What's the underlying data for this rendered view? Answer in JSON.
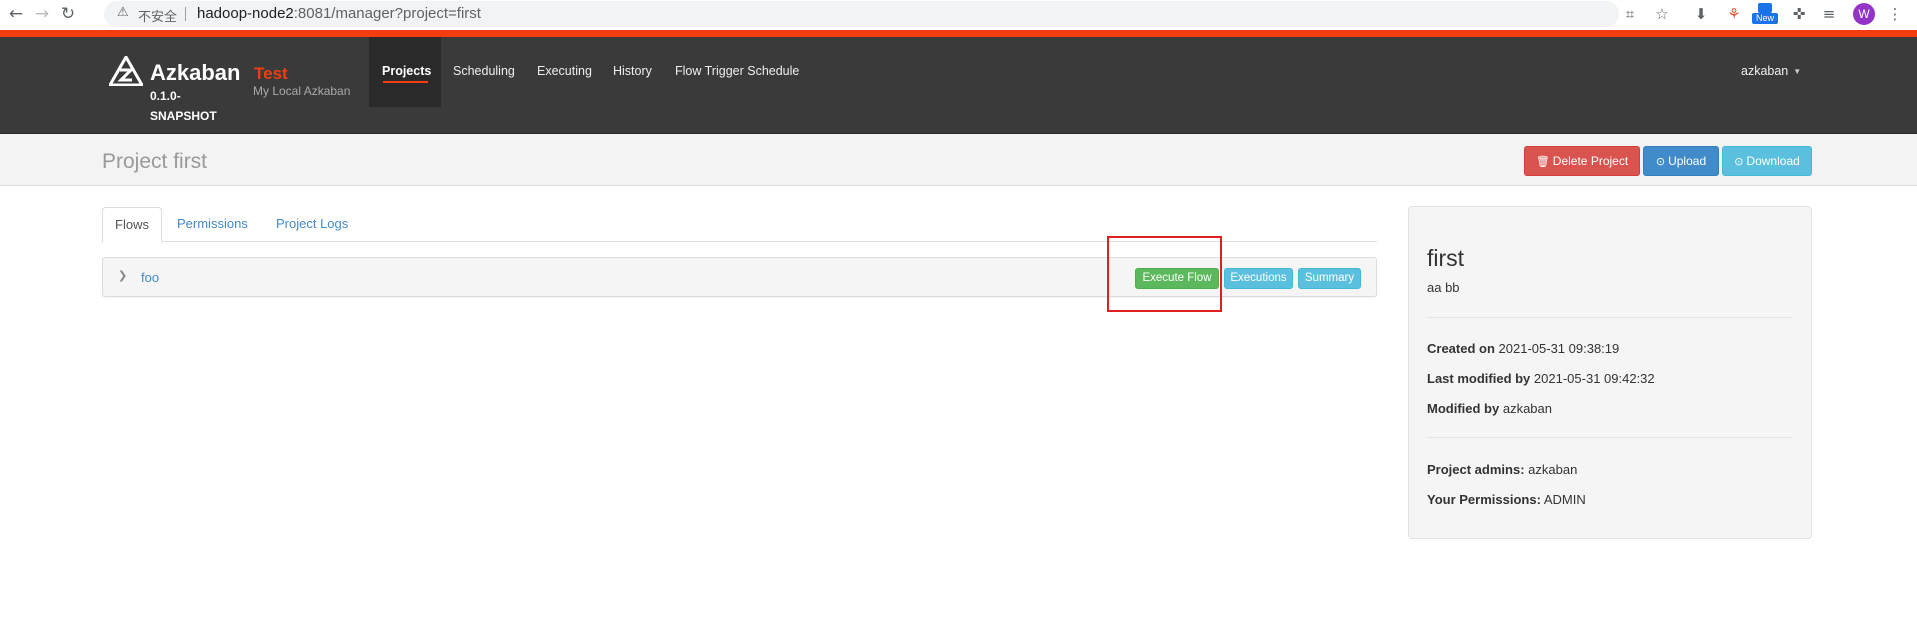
{
  "browser": {
    "insecure_label": "不安全",
    "url_host": "hadoop-node2",
    "url_rest": ":8081/manager?project=first",
    "ext_new_label": "New",
    "avatar_letter": "W"
  },
  "navbar": {
    "brand": "Azkaban",
    "version": "0.1.0-SNAPSHOT",
    "env_name": "Test",
    "env_description": "My Local Azkaban",
    "links": [
      "Projects",
      "Scheduling",
      "Executing",
      "History",
      "Flow Trigger Schedule"
    ],
    "active_link": "Projects",
    "user": "azkaban"
  },
  "header": {
    "title": "Project first",
    "delete_label": "Delete Project",
    "upload_label": "Upload",
    "download_label": "Download"
  },
  "tabs": {
    "flows": "Flows",
    "permissions": "Permissions",
    "project_logs": "Project Logs"
  },
  "flows": [
    {
      "name": "foo",
      "execute_label": "Execute Flow",
      "executions_label": "Executions",
      "summary_label": "Summary"
    }
  ],
  "project_info": {
    "name": "first",
    "description": "aa bb",
    "created_on_label": "Created on",
    "created_on": "2021-05-31 09:38:19",
    "last_modified_label": "Last modified by",
    "last_modified": "2021-05-31 09:42:32",
    "modified_by_label": "Modified by",
    "modified_by": "azkaban",
    "admins_label": "Project admins:",
    "admins": "azkaban",
    "permissions_label": "Your Permissions:",
    "permissions": "ADMIN"
  },
  "colors": {
    "accent": "#f23d12",
    "navbar": "#3a3a3a",
    "danger": "#d9534f",
    "primary": "#428bca",
    "info": "#5bc0de",
    "success": "#5cb85c"
  }
}
